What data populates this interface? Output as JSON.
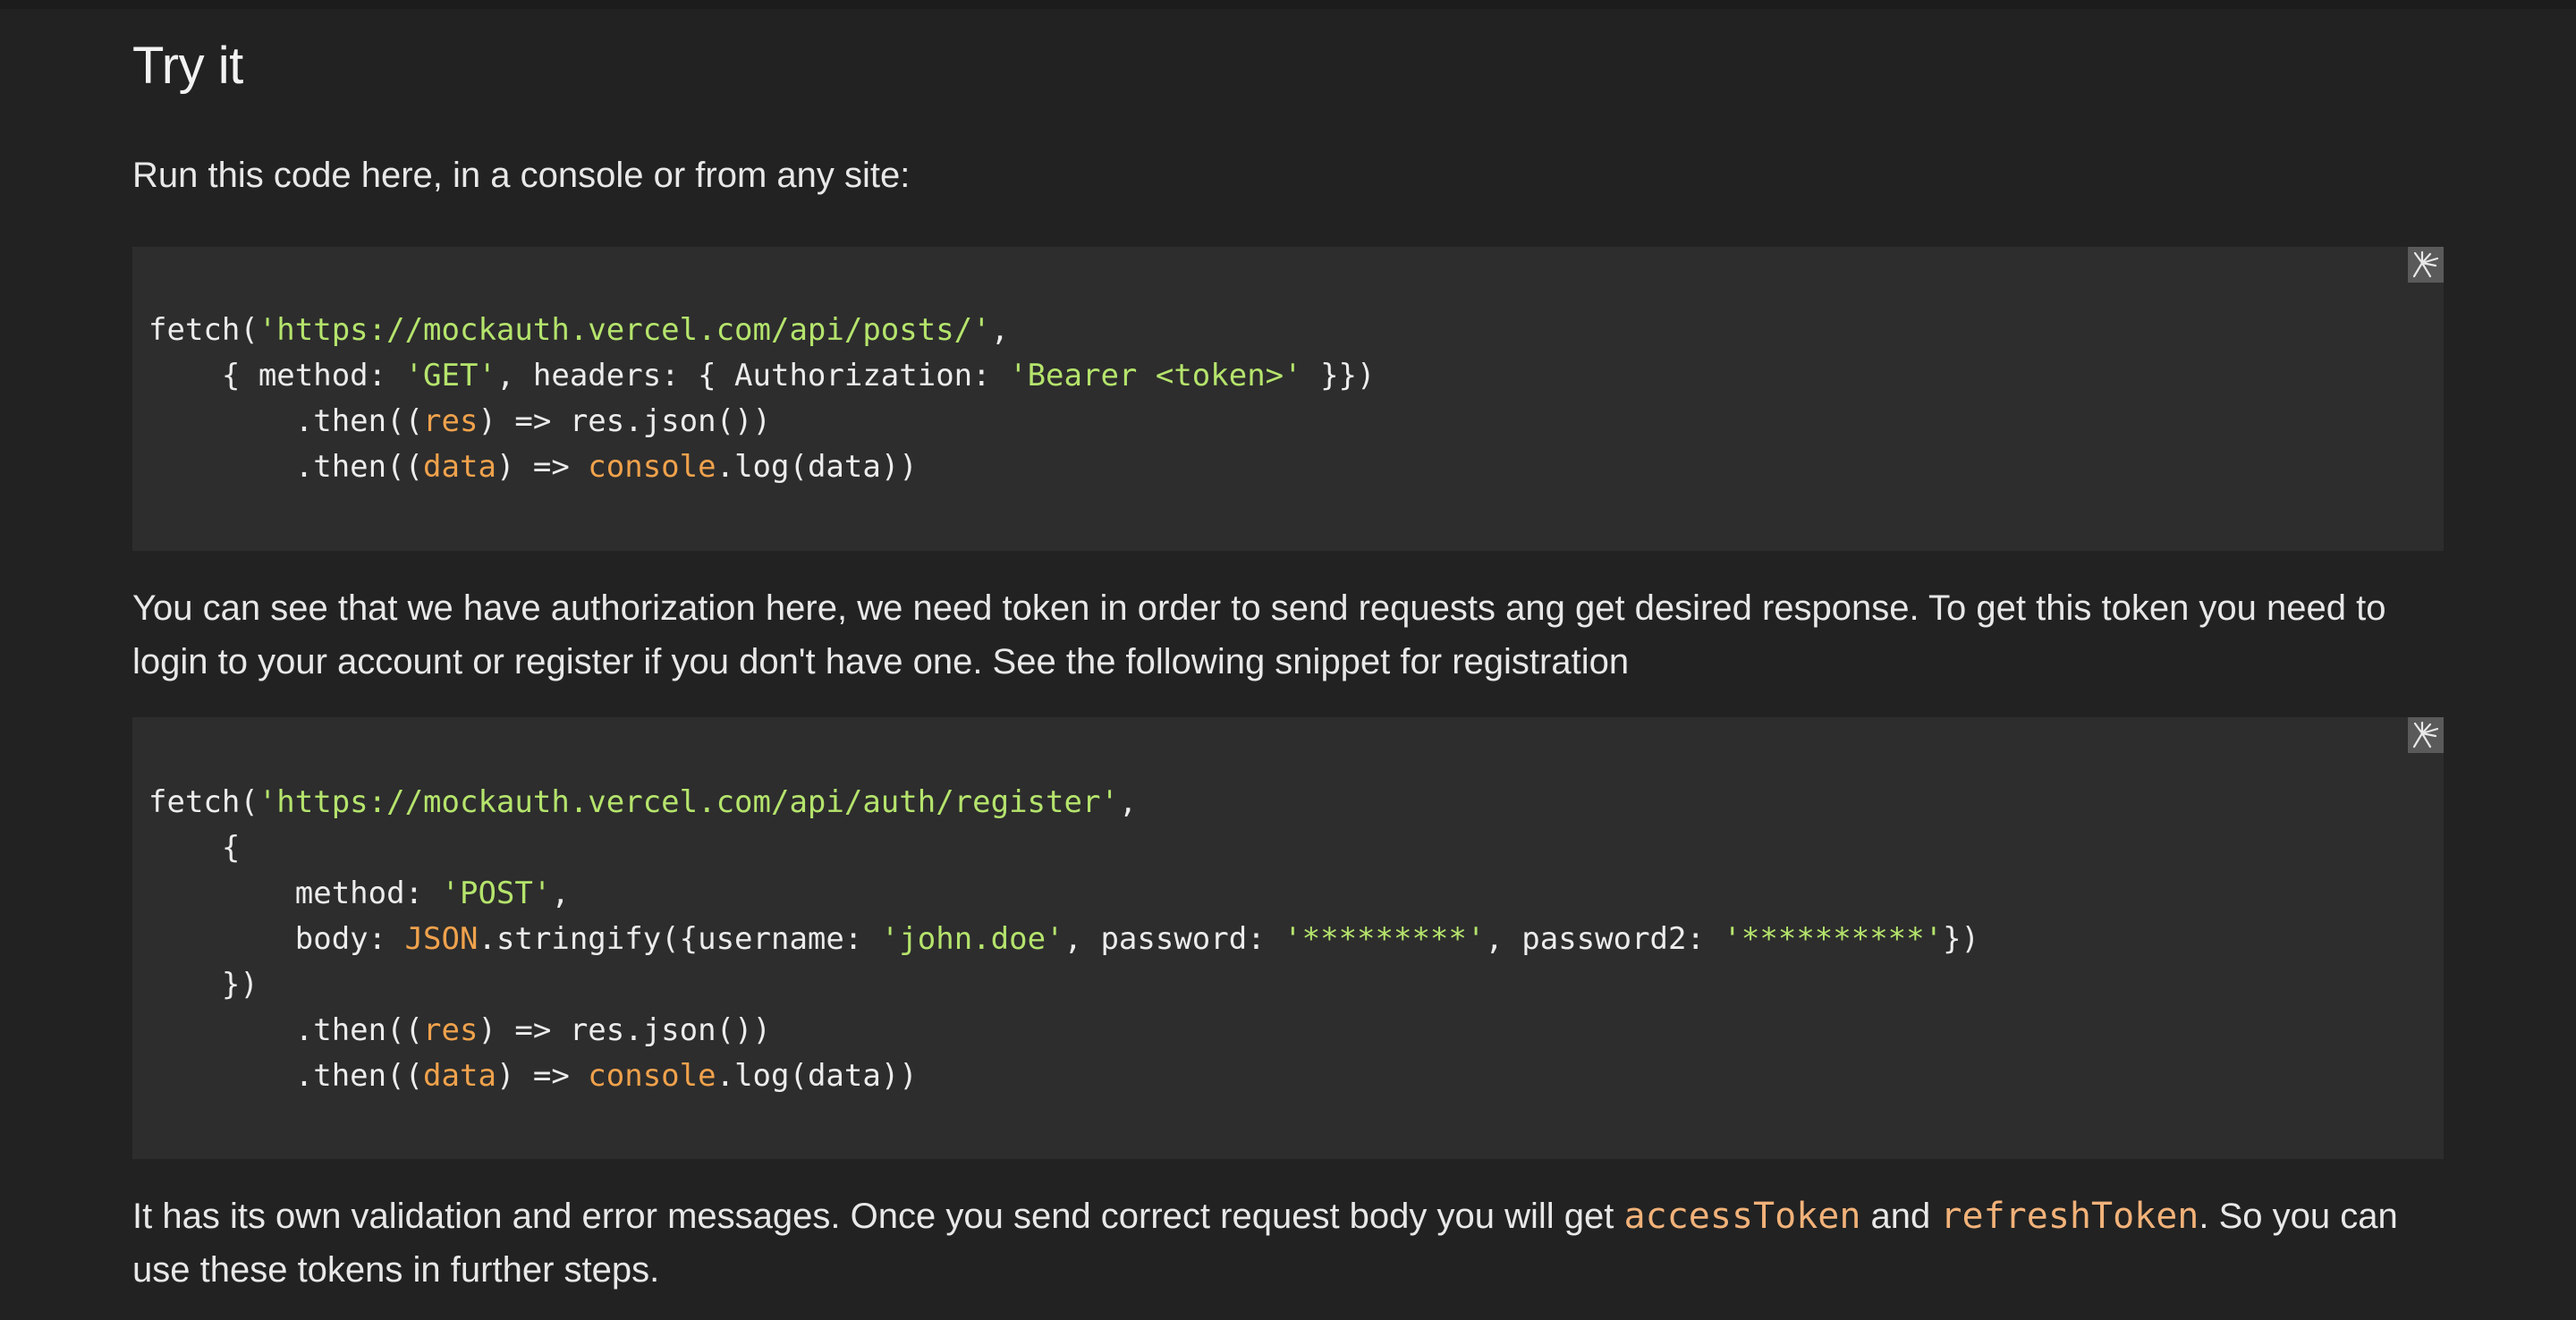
{
  "section": {
    "title": "Try it",
    "intro": "Run this code here, in a console or from any site:"
  },
  "code1": {
    "l1a": "fetch(",
    "l1b": "'https://mockauth.vercel.com/api/posts/'",
    "l1c": ",",
    "l2a": "    { method: ",
    "l2b": "'GET'",
    "l2c": ", headers: { Authorization: ",
    "l2d": "'Bearer <token>'",
    "l2e": " }})",
    "l3a": "        .then((",
    "l3b": "res",
    "l3c": ") => res.json())",
    "l4a": "        .then((",
    "l4b": "data",
    "l4c": ") => ",
    "l4d": "console",
    "l4e": ".log(data))"
  },
  "para2": "You can see that we have authorization here, we need token in order to send requests ang get desired response. To get this token you need to login to your account or register if you don't have one. See the following snippet for registration",
  "code2": {
    "l1a": "fetch(",
    "l1b": "'https://mockauth.vercel.com/api/auth/register'",
    "l1c": ",",
    "l2": "    {",
    "l3a": "        method: ",
    "l3b": "'POST'",
    "l3c": ",",
    "l4a": "        body: ",
    "l4b": "JSON",
    "l4c": ".stringify({username: ",
    "l4d": "'john.doe'",
    "l4e": ", password: ",
    "l4f": "'*********'",
    "l4g": ", password2: ",
    "l4h": "'**********'",
    "l4i": "})",
    "l5": "    })",
    "l6a": "        .then((",
    "l6b": "res",
    "l6c": ") => res.json())",
    "l7a": "        .then((",
    "l7b": "data",
    "l7c": ") => ",
    "l7d": "console",
    "l7e": ".log(data))"
  },
  "para3": {
    "t1": "It has its own validation and error messages. Once you send correct request body you will get ",
    "code1": "accessToken",
    "t2": " and ",
    "code2": "refreshToken",
    "t3": ". So you can use these tokens in further steps."
  },
  "icons": {
    "copy": "copy-code-icon"
  },
  "colors": {
    "background": "#222222",
    "code_background": "#2d2d2d",
    "string": "#b5e46c",
    "variable": "#f0a24c",
    "inline_code": "#f2b279"
  }
}
